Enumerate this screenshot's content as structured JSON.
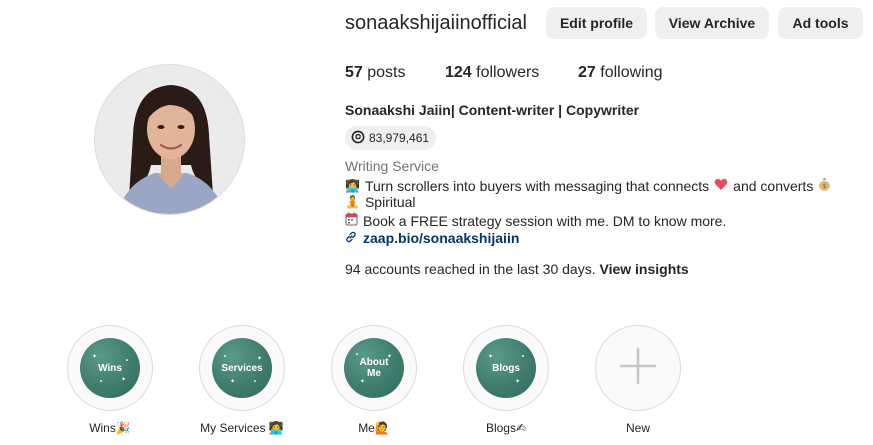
{
  "profile": {
    "username": "sonaakshijaiinofficial",
    "buttons": {
      "edit": "Edit profile",
      "archive": "View Archive",
      "ad_tools": "Ad tools"
    },
    "stats": {
      "posts_count": "57",
      "posts_label": "posts",
      "followers_count": "124",
      "followers_label": "followers",
      "following_count": "27",
      "following_label": "following"
    },
    "full_name": "Sonaakshi Jaiin| Content-writer | Copywriter",
    "threads_count": "83,979,461",
    "category": "Writing Service",
    "bio": {
      "line1_a": "Turn scrollers into buyers with messaging that connects",
      "line1_b": "and converts",
      "line2": "Spiritual",
      "line3": "Book a FREE strategy session with me. DM to know more."
    },
    "link": "zaap.bio/sonaakshijaiin",
    "insights_text": "94 accounts reached in the last 30 days.",
    "insights_link": "View insights"
  },
  "highlights": [
    {
      "cover": "Wins",
      "label": "Wins",
      "emoji": "🎉"
    },
    {
      "cover": "Services",
      "label": "My Services",
      "emoji": "👩‍💻"
    },
    {
      "cover": "About Me",
      "label": "Me",
      "emoji": "🙋"
    },
    {
      "cover": "Blogs",
      "label": "Blogs",
      "emoji": "✍"
    },
    {
      "cover": "",
      "label": "New",
      "emoji": ""
    }
  ],
  "icons": {
    "threads": "threads-icon",
    "link": "link-icon",
    "add": "plus-icon"
  },
  "colors": {
    "button_bg": "#efefef",
    "link_blue": "#00376b",
    "highlight_green": "#3f7c6e",
    "muted_text": "#737373",
    "heart": "#ed4956"
  }
}
